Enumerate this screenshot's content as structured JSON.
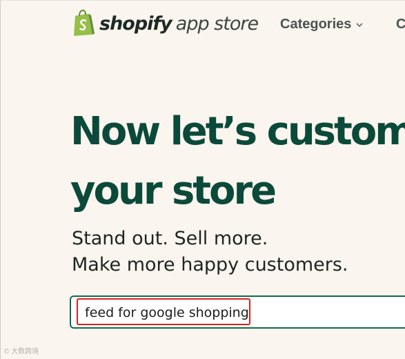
{
  "header": {
    "logo_word": "shopify",
    "logo_sub": "app store",
    "nav": [
      {
        "label": "Categories"
      },
      {
        "label": "C"
      }
    ]
  },
  "hero": {
    "title_line1": "Now let’s customiz",
    "title_line2": "your store",
    "sub_line1": "Stand out. Sell more.",
    "sub_line2": "Make more happy customers."
  },
  "search": {
    "value": "feed for google shopping"
  },
  "watermark": "© 大数跨境",
  "colors": {
    "background": "#faf5ee",
    "heading": "#0b4a3a",
    "logo_green": "#95bf47",
    "search_border": "#0e6b4e",
    "highlight": "#d9221c"
  }
}
